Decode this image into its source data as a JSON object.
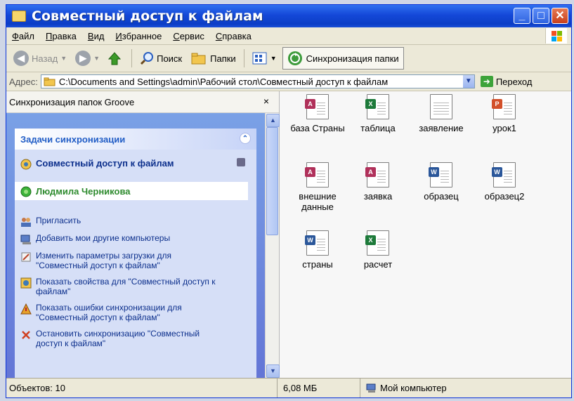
{
  "window": {
    "title": "Совместный доступ к файлам"
  },
  "menu": [
    "Файл",
    "Правка",
    "Вид",
    "Избранное",
    "Сервис",
    "Справка"
  ],
  "toolbar": {
    "back": "Назад",
    "search": "Поиск",
    "folders": "Папки",
    "sync": "Синхронизация папки"
  },
  "address": {
    "label": "Адрес:",
    "path": "C:\\Documents and Settings\\admin\\Рабочий стол\\Совместный доступ к файлам",
    "go": "Переход"
  },
  "pane": {
    "title": "Синхронизация папок Groove",
    "close": "×",
    "tasks_title": "Задачи синхронизации",
    "workspace": "Совместный доступ к файлам",
    "user": "Людмила Черникова",
    "actions": [
      "Пригласить",
      "Добавить мои другие компьютеры",
      "Изменить параметры загрузки для \"Совместный доступ к файлам\"",
      "Показать свойства для \"Совместный доступ к файлам\"",
      "Показать ошибки синхронизации для \"Совместный доступ к файлам\"",
      "Остановить синхронизацию \"Совместный доступ к файлам\""
    ]
  },
  "files": [
    {
      "name": "база Страны",
      "type": "access"
    },
    {
      "name": "таблица",
      "type": "excel"
    },
    {
      "name": "заявление",
      "type": "text"
    },
    {
      "name": "урок1",
      "type": "powerpoint"
    },
    {
      "name": "внешние данные",
      "type": "access"
    },
    {
      "name": "заявка",
      "type": "access-form"
    },
    {
      "name": "образец",
      "type": "word"
    },
    {
      "name": "образец2",
      "type": "word"
    },
    {
      "name": "страны",
      "type": "word"
    },
    {
      "name": "расчет",
      "type": "excel"
    }
  ],
  "status": {
    "objects": "Объектов: 10",
    "size": "6,08 МБ",
    "location": "Мой компьютер"
  },
  "colors": {
    "titlebar": "#1448d8",
    "task_link": "#0c2f8c",
    "user": "#2e8b2e"
  }
}
